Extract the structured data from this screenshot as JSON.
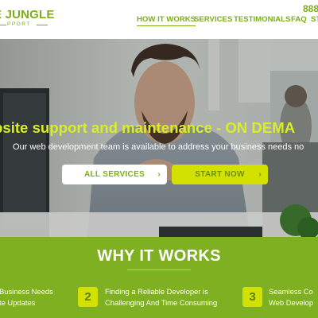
{
  "header": {
    "logo": {
      "name": "E JUNGLE",
      "sub": "PPORT"
    },
    "nav": [
      {
        "label": "HOW IT WORKS",
        "active": true
      },
      {
        "label": "SERVICES",
        "active": false
      },
      {
        "label": "TESTIMONIALS",
        "active": false
      },
      {
        "label": "FAQ",
        "active": false
      },
      {
        "label": "ST",
        "active": false
      }
    ],
    "phone": "888"
  },
  "hero": {
    "title": "bsite support and maintenance - ON DEMA",
    "subtitle": "Our web development team is available to address your business needs no",
    "buttons": {
      "all_services": "ALL SERVICES",
      "start_now": "START NOW",
      "chevron": "›"
    }
  },
  "why": {
    "title": "WHY IT WORKS",
    "steps": [
      {
        "num": "",
        "line1": "Business Needs",
        "line2": "te Updates"
      },
      {
        "num": "2",
        "line1": "Finding a Reliable Developer is",
        "line2": "Challenging And Time Consuming"
      },
      {
        "num": "3",
        "line1": "Seamless Co",
        "line2": "Web Develop"
      }
    ]
  },
  "colors": {
    "brand_green": "#7bae19",
    "accent_yellow": "#d2e100",
    "hero_title": "#d9ee24",
    "section_bg": "#7fb021"
  }
}
